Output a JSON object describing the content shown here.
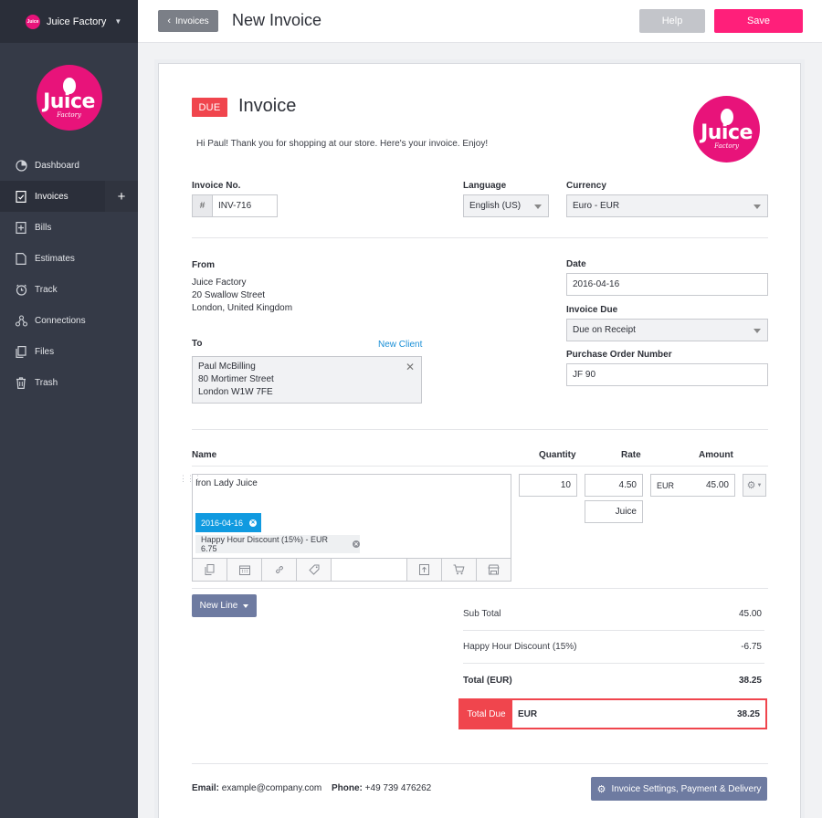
{
  "app": {
    "workspace_name": "Juice Factory",
    "logo_word": "Juice",
    "logo_sub": "Factory",
    "logo_mini_text": "Juice"
  },
  "sidebar": {
    "items": [
      {
        "label": "Dashboard",
        "icon": "dashboard-icon"
      },
      {
        "label": "Invoices",
        "icon": "invoice-icon",
        "active": true,
        "add": "+"
      },
      {
        "label": "Bills",
        "icon": "bill-icon"
      },
      {
        "label": "Estimates",
        "icon": "estimate-icon"
      },
      {
        "label": "Track",
        "icon": "clock-icon"
      },
      {
        "label": "Connections",
        "icon": "connections-icon"
      },
      {
        "label": "Files",
        "icon": "files-icon"
      },
      {
        "label": "Trash",
        "icon": "trash-icon"
      }
    ]
  },
  "topbar": {
    "back_label": "Invoices",
    "title": "New Invoice",
    "help_label": "Help",
    "save_label": "Save"
  },
  "invoice": {
    "status_badge": "DUE",
    "heading": "Invoice",
    "greeting": "Hi Paul! Thank you for shopping at our store. Here's your invoice. Enjoy!",
    "number_label": "Invoice No.",
    "number_prefix": "#",
    "number_value": "INV-716",
    "language_label": "Language",
    "language_value": "English (US)",
    "currency_label": "Currency",
    "currency_value": "Euro - EUR",
    "from_label": "From",
    "from_lines": [
      "Juice Factory",
      "20 Swallow Street",
      "London, United Kingdom"
    ],
    "to_label": "To",
    "new_client_label": "New Client",
    "to_lines": [
      "Paul McBilling",
      "80 Mortimer Street",
      "London W1W 7FE"
    ],
    "date_label": "Date",
    "date_value": "2016-04-16",
    "due_label": "Invoice Due",
    "due_value": "Due on Receipt",
    "po_label": "Purchase Order Number",
    "po_value": "JF 90"
  },
  "lines": {
    "headers": {
      "name": "Name",
      "quantity": "Quantity",
      "rate": "Rate",
      "amount": "Amount"
    },
    "items": [
      {
        "name": "Iron Lady Juice",
        "quantity": "10",
        "rate": "4.50",
        "unit": "Juice",
        "currency": "EUR",
        "amount": "45.00",
        "date_tag": "2016-04-16",
        "discount_tag": "Happy Hour Discount (15%) - EUR 6.75"
      }
    ],
    "new_line_label": "New Line"
  },
  "totals": {
    "subtotal_label": "Sub Total",
    "subtotal_value": "45.00",
    "discount_label": "Happy Hour Discount (15%)",
    "discount_value": "-6.75",
    "total_label": "Total (EUR)",
    "total_value": "38.25",
    "due_label": "Total Due",
    "due_currency": "EUR",
    "due_value": "38.25"
  },
  "footer": {
    "email_label": "Email:",
    "email_value": "example@company.com",
    "phone_label": "Phone:",
    "phone_value": "+49 739 476262",
    "settings_label": "Invoice Settings, Payment & Delivery"
  },
  "colors": {
    "accent_pink": "#ff1f7a",
    "due_red": "#f0454d",
    "date_tag_blue": "#109ae0",
    "slate_button": "#6e7ba1",
    "sidebar_bg": "#353a47"
  }
}
